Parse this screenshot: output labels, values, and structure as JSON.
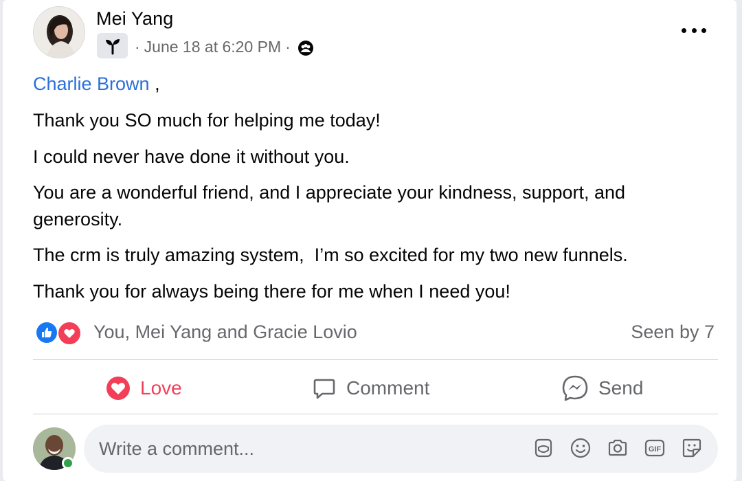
{
  "post": {
    "author": "Mei Yang",
    "timestamp": "June 18 at 6:20 PM",
    "separator": "·",
    "group_icon": "sprout-icon",
    "audience_icon": "group-audience-icon",
    "mention": "Charlie Brown",
    "mention_suffix": " ,",
    "paragraphs": [
      "Thank you SO much for helping me today!",
      "I could never have done it without you.",
      "You are a wonderful friend, and I appreciate your kindness, support, and generosity.",
      "The crm is truly amazing system,  I’m so excited for my two new funnels.",
      "Thank you for always being there for me when I need you!"
    ]
  },
  "reactions": {
    "types": [
      "like",
      "love"
    ],
    "names": "You, Mei Yang and Gracie Lovio",
    "seen": "Seen by 7"
  },
  "actions": {
    "love": "Love",
    "comment": "Comment",
    "send": "Send"
  },
  "comment_box": {
    "placeholder": "Write a comment...",
    "tools": [
      "avatar-sticker-icon",
      "emoji-icon",
      "camera-icon",
      "gif-icon",
      "sticker-icon"
    ]
  },
  "colors": {
    "mention": "#2a6fdb",
    "love": "#f33e58",
    "like": "#1877f2",
    "secondary_text": "#65676b",
    "online": "#31a24c"
  }
}
